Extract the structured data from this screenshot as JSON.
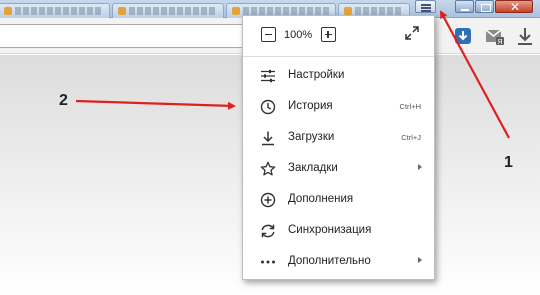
{
  "window": {
    "colors": {
      "titlebar": "#b6cbe6",
      "close": "#c4432b"
    }
  },
  "menu": {
    "zoom": {
      "value": "100%",
      "minus_icon": "minus-icon",
      "plus_icon": "plus-icon",
      "fullscreen_icon": "fullscreen-icon"
    },
    "items": [
      {
        "label": "Настройки",
        "icon": "settings-sliders-icon"
      },
      {
        "label": "История",
        "icon": "clock-icon",
        "shortcut": "Ctrl+H"
      },
      {
        "label": "Загрузки",
        "icon": "download-icon",
        "shortcut": "Ctrl+J"
      },
      {
        "label": "Закладки",
        "icon": "star-icon",
        "submenu": true
      },
      {
        "label": "Дополнения",
        "icon": "plus-circle-icon"
      },
      {
        "label": "Синхронизация",
        "icon": "sync-icon"
      },
      {
        "label": "Дополнительно",
        "icon": "more-dots-icon",
        "submenu": true
      }
    ]
  },
  "annotations": {
    "label_1": "1",
    "label_2": "2",
    "arrow_color": "#e0201e"
  }
}
